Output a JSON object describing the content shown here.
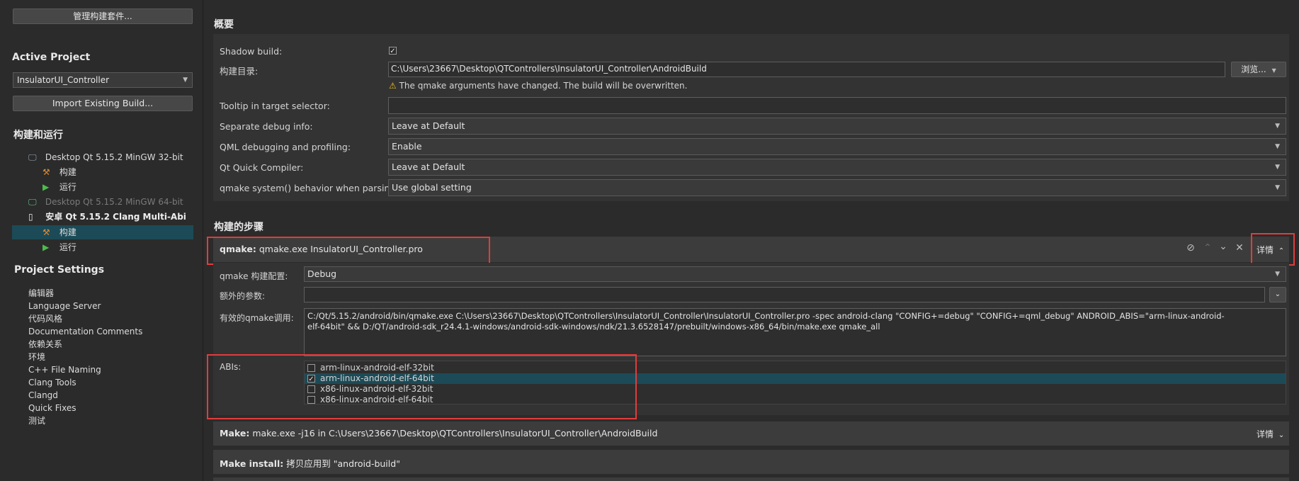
{
  "sidebar": {
    "manage_kits_label": "管理构建套件...",
    "active_project_title": "Active Project",
    "project_select": "InsulatorUI_Controller",
    "import_build_label": "Import Existing Build...",
    "build_run_title": "构建和运行",
    "kits": [
      {
        "name": "Desktop Qt 5.15.2 MinGW 32-bit",
        "build": "构建",
        "run": "运行"
      },
      {
        "name": "Desktop Qt 5.15.2 MinGW 64-bit"
      },
      {
        "name": "安卓 Qt 5.15.2 Clang Multi-Abi",
        "build": "构建",
        "run": "运行"
      }
    ],
    "project_settings_title": "Project Settings",
    "settings_items": [
      "编辑器",
      "Language Server",
      "代码风格",
      "Documentation Comments",
      "依赖关系",
      "环境",
      "C++ File Naming",
      "Clang Tools",
      "Clangd",
      "Quick Fixes",
      "测试"
    ]
  },
  "overview": {
    "title": "概要",
    "shadow_build_label": "Shadow build:",
    "build_dir_label": "构建目录:",
    "build_dir_value": "C:\\Users\\23667\\Desktop\\QTControllers\\InsulatorUI_Controller\\AndroidBuild",
    "browse_label": "浏览...",
    "warning_text": "The qmake arguments have changed. The build will be overwritten.",
    "tooltip_label": "Tooltip in target selector:",
    "tooltip_value": "",
    "separate_debug_label": "Separate debug info:",
    "separate_debug_value": "Leave at Default",
    "qml_debug_label": "QML debugging and profiling:",
    "qml_debug_value": "Enable",
    "qt_quick_compiler_label": "Qt Quick Compiler:",
    "qt_quick_compiler_value": "Leave at Default",
    "qmake_system_label": "qmake system() behavior when parsing:",
    "qmake_system_value": "Use global setting"
  },
  "build_steps": {
    "title": "构建的步骤",
    "qmake": {
      "header_bold": "qmake:",
      "header_text": "qmake.exe InsulatorUI_Controller.pro",
      "details_label": "详情",
      "config_label": "qmake 构建配置:",
      "config_value": "Debug",
      "extra_args_label": "额外的参数:",
      "extra_args_value": "",
      "effective_label": "有效的qmake调用:",
      "effective_line1": "C:/Qt/5.15.2/android/bin/qmake.exe C:\\Users\\23667\\Desktop\\QTControllers\\InsulatorUI_Controller\\InsulatorUI_Controller.pro -spec android-clang \"CONFIG+=debug\" \"CONFIG+=qml_debug\" ANDROID_ABIS=\"arm-linux-android-",
      "effective_line2": "elf-64bit\" && D:/QT/android-sdk_r24.4.1-windows/android-sdk-windows/ndk/21.3.6528147/prebuilt/windows-x86_64/bin/make.exe qmake_all",
      "abis_label": "ABIs:",
      "abis": [
        {
          "name": "arm-linux-android-elf-32bit",
          "checked": false
        },
        {
          "name": "arm-linux-android-elf-64bit",
          "checked": true
        },
        {
          "name": "x86-linux-android-elf-32bit",
          "checked": false
        },
        {
          "name": "x86-linux-android-elf-64bit",
          "checked": false
        }
      ]
    },
    "make": {
      "header_bold": "Make:",
      "header_text": "make.exe -j16 in C:\\Users\\23667\\Desktop\\QTControllers\\InsulatorUI_Controller\\AndroidBuild",
      "details_label": "详情"
    },
    "make_install": {
      "header_bold": "Make install:",
      "header_text": "拷贝应用到 \"android-build\""
    }
  },
  "colors": {
    "selected_row": "#1c4b57",
    "highlight_box": "#e33b3b",
    "warning": "#f0c020"
  }
}
